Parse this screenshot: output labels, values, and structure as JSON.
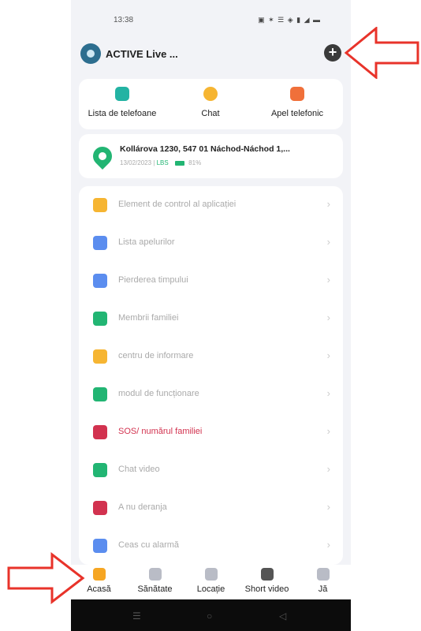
{
  "status": {
    "time": "13:38",
    "icons": "▣ ✶ ☰ ◈ ▮ ◢ ▬"
  },
  "header": {
    "title": "ACTIVE Live ...",
    "add_symbol": "+"
  },
  "quick_actions": [
    {
      "label": "Lista de telefoane",
      "icon": "contacts-icon",
      "color": "#23b3a3"
    },
    {
      "label": "Chat",
      "icon": "chat-bubble-icon",
      "color": "#f6b532"
    },
    {
      "label": "Apel telefonic",
      "icon": "phone-call-icon",
      "color": "#f0703a"
    }
  ],
  "location": {
    "address": "Kollárova 1230, 547 01 Náchod-Náchod 1,...",
    "date": "13/02/2023 |",
    "source": "LBS",
    "battery": "81%",
    "icon": "location-pin-icon",
    "color": "#22b573"
  },
  "menu": [
    {
      "label": "Element de control al aplicației",
      "icon": "app-control-icon",
      "color": "#f6b532"
    },
    {
      "label": "Lista apelurilor",
      "icon": "call-list-icon",
      "color": "#5b8def"
    },
    {
      "label": "Pierderea timpului",
      "icon": "time-loss-icon",
      "color": "#5b8def"
    },
    {
      "label": "Membrii familiei",
      "icon": "family-members-icon",
      "color": "#22b573"
    },
    {
      "label": "centru de informare",
      "icon": "info-center-icon",
      "color": "#f6b532"
    },
    {
      "label": "modul de funcționare",
      "icon": "work-mode-icon",
      "color": "#22b573"
    },
    {
      "label": "SOS/ numărul familiei",
      "icon": "sos-icon",
      "color": "#d2324f"
    },
    {
      "label": "Chat video",
      "icon": "video-call-icon",
      "color": "#22b573"
    },
    {
      "label": "A nu deranja",
      "icon": "do-not-disturb-icon",
      "color": "#d2324f"
    },
    {
      "label": "Ceas cu alarmă",
      "icon": "alarm-clock-icon",
      "color": "#5b8def"
    }
  ],
  "chevron": "›",
  "tabs": [
    {
      "label": "Acasă",
      "icon": "home-icon",
      "color": "#f6a623"
    },
    {
      "label": "Sănătate",
      "icon": "heart-icon",
      "color": "#b9bcc6"
    },
    {
      "label": "Locație",
      "icon": "location-icon",
      "color": "#b9bcc6"
    },
    {
      "label": "Short video",
      "icon": "camera-icon",
      "color": "#555555"
    },
    {
      "label": "Jă",
      "icon": "person-icon",
      "color": "#b9bcc6"
    }
  ],
  "navbar": {
    "menu": "☰",
    "home": "○",
    "back": "◁"
  },
  "annotation_color": "#e8332a"
}
